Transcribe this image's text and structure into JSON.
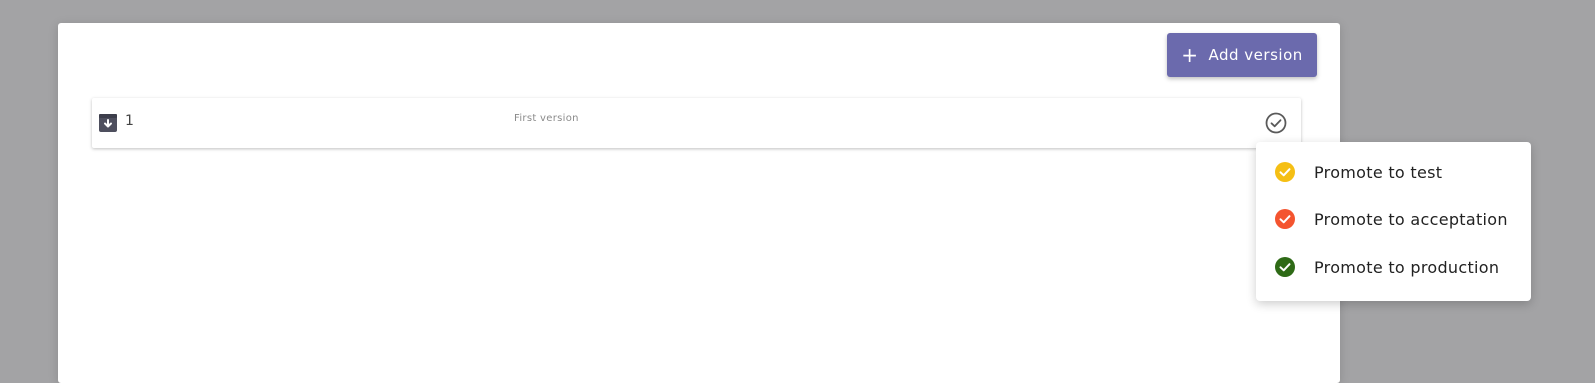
{
  "header": {
    "add_version_label": "Add version",
    "add_version_icon": "plus-icon",
    "add_version_color": "#6b6aad"
  },
  "versions": [
    {
      "number": "1",
      "description": "First version",
      "icon": "archive-download-icon",
      "status_icon": "check-circle-outline-icon"
    }
  ],
  "promote_menu": {
    "items": [
      {
        "label": "Promote to test",
        "icon": "check-circle-icon",
        "color": "#f5bf14"
      },
      {
        "label": "Promote to acceptation",
        "icon": "check-circle-icon",
        "color": "#f4542f"
      },
      {
        "label": "Promote to production",
        "icon": "check-circle-icon",
        "color": "#2e6a16"
      }
    ]
  }
}
